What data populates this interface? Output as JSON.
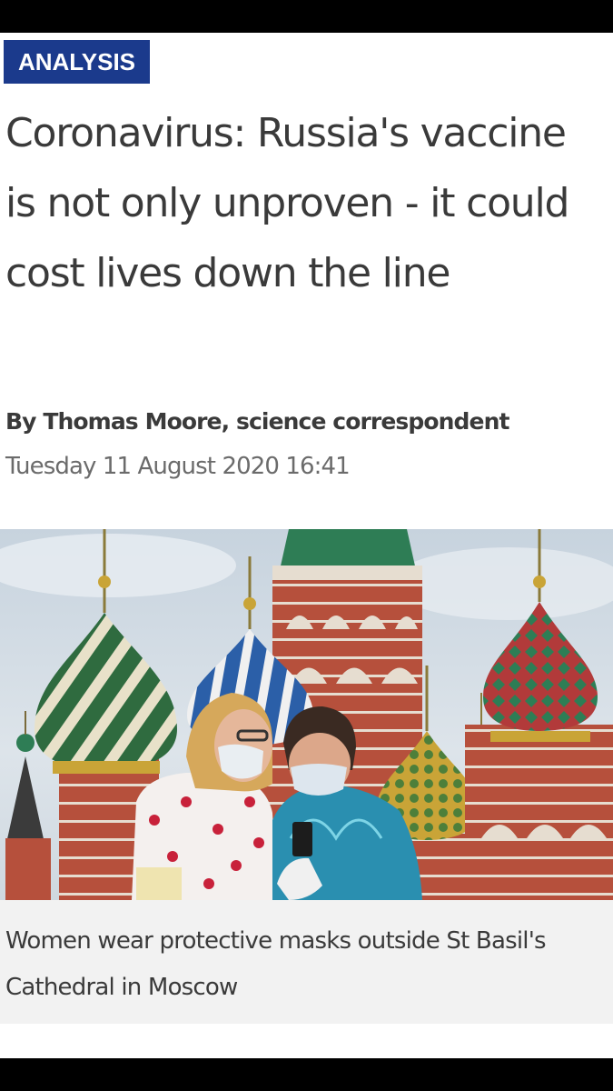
{
  "article": {
    "category": "ANALYSIS",
    "headline": "Coronavirus: Russia's vaccine is not only unproven - it could cost lives down the line",
    "byline": "By Thomas Moore, science correspondent",
    "date": "Tuesday 11 August 2020  16:41"
  },
  "photo": {
    "caption": "Women wear protective masks outside St Basil's Cathedral in Moscow"
  },
  "colors": {
    "badge_background": "#1b3a8c",
    "headline_text": "#3a3a3a",
    "date_text": "#6b6b6b",
    "caption_background": "#f2f2f2"
  }
}
